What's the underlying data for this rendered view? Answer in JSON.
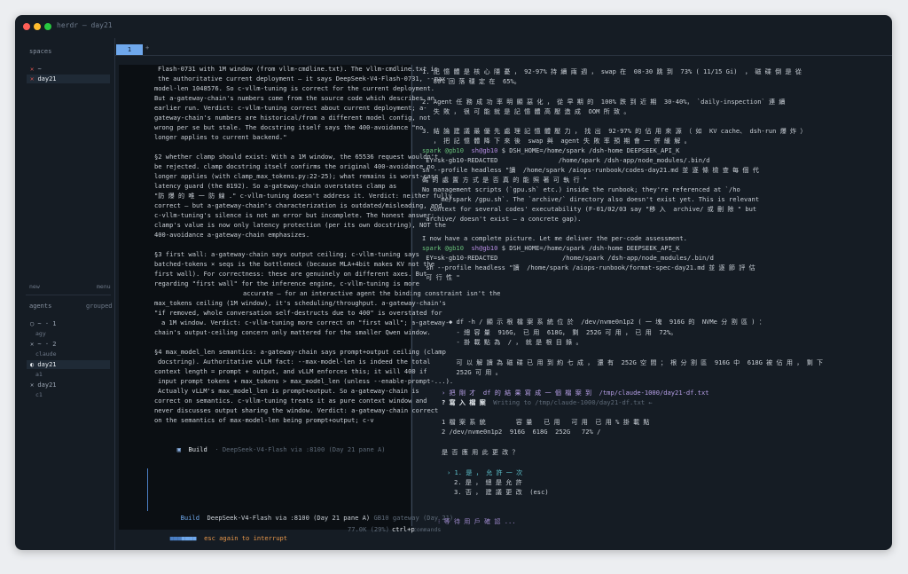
{
  "window": {
    "title": "herdr — day21"
  },
  "sidebar": {
    "spaces_label": "spaces",
    "spaces": [
      {
        "mark": "✕",
        "name": "~"
      },
      {
        "mark": "✕",
        "name": "day21"
      }
    ],
    "new_label": "new",
    "menu_label": "menu",
    "agents_label": "agents",
    "grouped_label": "grouped",
    "agents": [
      {
        "row": "◯ ~ · 1",
        "sub": "agy"
      },
      {
        "row": "✕ ~ · 2",
        "sub": "claude"
      },
      {
        "row": "◐ day21",
        "sub": "a1"
      },
      {
        "row": "✕ day21",
        "sub": "c1"
      }
    ]
  },
  "tabs": {
    "active": "1",
    "add": "+"
  },
  "left_pane": {
    "lines": [
      "Flash-0731 with 1M window (from vllm-cmdline.txt). The vllm-cmdline.txt is",
      "the authoritative current deployment — it says DeepSeek-V4-Flash-0731, --max-",
      "model-len 1048576. So c-vllm-tuning is correct for the current deployment.",
      "But a-gateway-chain's numbers come from the source code which describes an",
      "earlier run. Verdict: c-vllm-tuning correct about current deployment; a-",
      "gateway-chain's numbers are historical/from a different model config, not",
      "wrong per se but stale. The docstring itself says the 400-avoidance \"no",
      "longer applies to current backend.\"",
      "§2 whether clamp should exist: With a 1M window, the 65536 request wouldn't",
      "be rejected. clamp docstring itself confirms the original 400-avoidance no",
      "longer applies (with clamp_max_tokens.py:22-25); what remains is worst-case",
      "latency guard (the 8192). So a-gateway-chain overstates clamp as",
      "\"防 爆 的 唯 一 防 線 .\" c-vllm-tuning doesn't address it. Verdict: neither fully",
      "correct — but a-gateway-chain's characterization is outdated/misleading, and",
      "c-vllm-tuning's silence is not an error but incomplete. The honest answer:",
      "clamp's value is now only latency protection (per its own docstring), NOT the",
      "400-avoidance a-gateway-chain emphasizes.",
      "§3 first wall: a-gateway-chain says output ceiling; c-vllm-tuning says",
      "batched-tokens × seqs is the bottleneck (because MLA+4bit makes KV not the",
      "first wall). For correctness: these are genuinely on different axes. But",
      "regarding \"first wall\" for the inference engine, c-vllm-tuning is more",
      "accurate — for an interactive agent the binding constraint isn't the",
      "max_tokens ceiling (1M window), it's scheduling/throughput. a-gateway-chain's",
      "\"if removed, whole conversation self-destructs due to 400\" is overstated for",
      "a 1M window. Verdict: c-vllm-tuning more correct on \"first wall\"; a-gateway-",
      "chain's output-ceiling concern only mattered for the smaller Qwen window.",
      "§4 max_model_len semantics: a-gateway-chain says prompt+output ceiling (clamp",
      "docstring). Authoritative vLLM fact: --max-model-len is indeed the total",
      "context length = prompt + output, and vLLM enforces this; it will 400 if",
      "input prompt tokens + max_tokens > max_model_len (unless --enable-prompt-...).",
      "Actually vLLM's max_model_len is prompt+output. So a-gateway-chain is",
      "correct on semantics. c-vllm-tuning treats it as pure context window and",
      "never discusses output sharing the window. Verdict: a-gateway-chain correct",
      "on the semantics of max-model-len being prompt+output; c-v"
    ],
    "build_line": {
      "label": "Build",
      "model": "DeepSeek-V4-Flash via :8100 (Day 21 pane A)"
    },
    "prompt_bar": {
      "label": "Build",
      "model": "DeepSeek-V4-Flash via :8100 (Day 21 pane A)",
      "gateway": "GB10 gateway (Day 21)"
    },
    "status": {
      "hint": "esc again to interrupt",
      "tokens": "77.0K (29%)",
      "shortcut": "ctrl+p",
      "shortcut_label": "commands"
    }
  },
  "right_pane": {
    "lines": [
      "1. 記 憶 體 是 核 心 隱 憂 ， 92-97% 持 續 兩 週 ， swap 在  08-30 跳 到  73% ( 11/15 Gi)  ， 磁 碟 倒 是 從",
      "   80% 回 落 穩 定 在  65%。",
      "2. Agent 任 務 成 功 率 明 顯 惡 化 ， 從 早 期 的  100% 跌 到 近 期  30-40%， `daily-inspection` 連 續",
      "   失 敗 ， 很 可 能 就 是 記 憶 體 高 壓 造 成  OOM 所 致 。",
      "3. 結 論 建 議 最 優 先 處 理 記 憶 體 壓 力 ， 找 出  92-97% 的 佔 用 來 源 （ 如  KV cache、 dsh-run 爆 炸 ）",
      "   ， 把 記 憶 體 降 下 來 後  swap 與  agent 失 敗 率 預 期 會 一 併 緩 解 。",
      "spark @gb10",
      " EY=sk-gb10-REDACTED                /home/spark /dsh-app/node_modules/.bin/d",
      "sh --profile headless \"讀  /home/spark /aiops-runbook/codes-day21.md 並 逐 條 檢 查 每 個 代",
      "碼 的 處 置 方 式 是 否 真 的 能 照 著 可 執 行 \"",
      "No management scripts (`gpu.sh` etc.) inside the runbook; they're referenced at `/ho",
      "     me/spark /gpu.sh`. The `archive/` directory also doesn't exist yet. This is relevant",
      "  context for several codes' executability (F-01/02/03 say \"移 入  archive/ 或 刪 除 \" but",
      " archive/ doesn't exist — a concrete gap).",
      "I now have a complete picture. Let me deliver the per-code assessment.",
      "spark @gb10",
      " EY=sk-gb10-REDACTED                 /home/spark /dsh-app/node_modules/.bin/d",
      " sh --profile headless \"讀  /home/spark /aiops-runbook/format-spec-day21.md 並 逐 節 評 估",
      " 可 行 性 \"",
      "◆ df -h / 顯 示 根 檔 案 系 統 位 於  /dev/nvme0n1p2 ( 一 塊  916G 的  NVMe 分 割 區 ) ：",
      "  - 總 容 量  916G， 已 用  618G， 剩  252G 可 用 ， 已 用  72%。",
      "  - 掛 載 點 為  / ， 就 是 根 目 錄 。",
      "  可 以 解 讀 為 磁 碟 已 用 到 約 七 成 ， 還 有  252G 空 間 ； 根 分 割 區  916G 中  618G 被 佔 用 ， 剩 下",
      "  252G 可 用 。",
      "› 把 剛 才  df 的 結 果 寫 成 一 個 檔 案 到  /tmp/claude-1000/day21-df.txt",
      "? 寫 入 檔 案",
      "1 檔 案 系 統        容 量   已 用   可 用  已 用 % 掛 載 點",
      "2 /dev/nvme0n1p2  916G  618G  252G   72% /",
      "是 否 應 用 此 更 改 ？",
      "› 1. 是 ， 允 許 一 次",
      "2. 是 ， 總 是 允 許",
      "3. 否 ， 建 議 更 改  (esc)",
      "⁝ 等 待 用 戶 確 認 ..."
    ],
    "prompt_host": "sh@gb10",
    "prompt_cmd": "$ DSH_HOME=/home/spark /dsh-home DEEPSEEK_API_K",
    "write_note": "Writing to /tmp/claude-1000/day21-df.txt ←"
  }
}
